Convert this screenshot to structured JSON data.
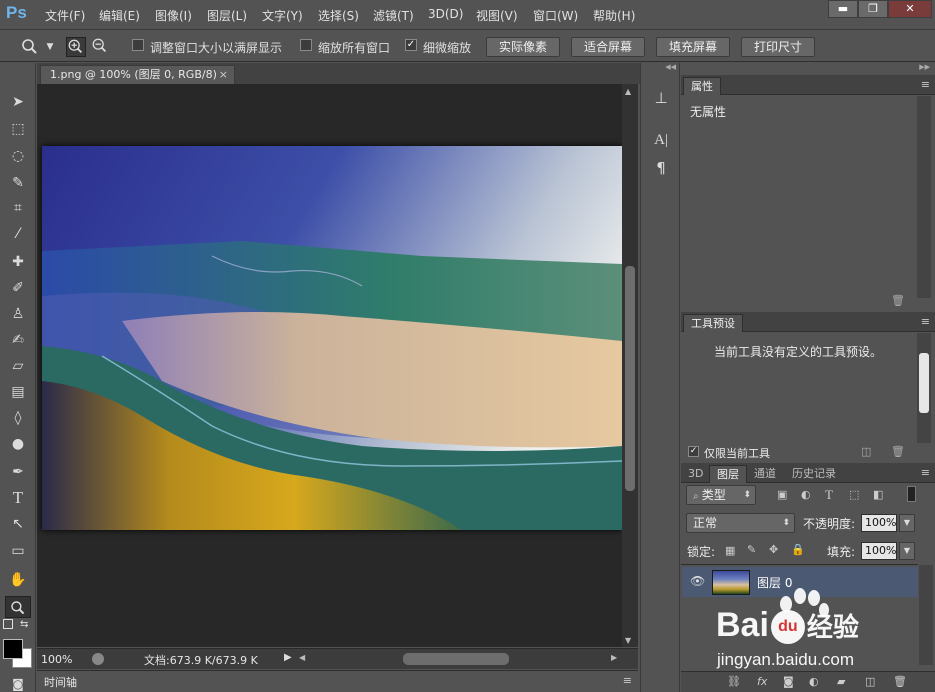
{
  "app": {
    "logo": "Ps",
    "menu": [
      "文件(F)",
      "编辑(E)",
      "图像(I)",
      "图层(L)",
      "文字(Y)",
      "选择(S)",
      "滤镜(T)",
      "3D(D)",
      "视图(V)",
      "窗口(W)",
      "帮助(H)"
    ],
    "window_buttons": [
      "▬",
      "❐",
      "✕"
    ]
  },
  "options": {
    "checkbox_resize": {
      "label": "调整窗口大小以满屏显示",
      "checked": false
    },
    "checkbox_zoom_all": {
      "label": "缩放所有窗口",
      "checked": false
    },
    "checkbox_scrubby": {
      "label": "细微缩放",
      "checked": true
    },
    "buttons": [
      "实际像素",
      "适合屏幕",
      "填充屏幕",
      "打印尺寸"
    ]
  },
  "document": {
    "tab_title": "1.png @ 100% (图层 0, RGB/8)",
    "close_glyph": "×",
    "zoom": "100%",
    "doc_info": "文档:673.9 K/673.9 K",
    "timeline_label": "时间轴"
  },
  "panels": {
    "properties": {
      "tab": "属性",
      "content": "无属性"
    },
    "tool_presets": {
      "tab": "工具预设",
      "message": "当前工具没有定义的工具预设。",
      "checkbox": {
        "label": "仅限当前工具",
        "checked": true
      }
    },
    "layers": {
      "tabs": [
        "3D",
        "图层",
        "通道",
        "历史记录"
      ],
      "active_tab": "图层",
      "filter_kind": "类型",
      "blend_mode": "正常",
      "opacity_label": "不透明度:",
      "opacity_value": "100%",
      "lock_label": "锁定:",
      "fill_label": "填充:",
      "fill_value": "100%",
      "layer_name": "图层 0"
    }
  },
  "watermark": {
    "brand": "Bai",
    "brand_tail": "du",
    "brand_cn": "经验",
    "url": "jingyan.baidu.com"
  },
  "colors": {
    "accent": "#6fb4ea",
    "panel_bg": "#535353",
    "canvas_bg": "#282828",
    "selected_layer": "#4b5a72"
  }
}
